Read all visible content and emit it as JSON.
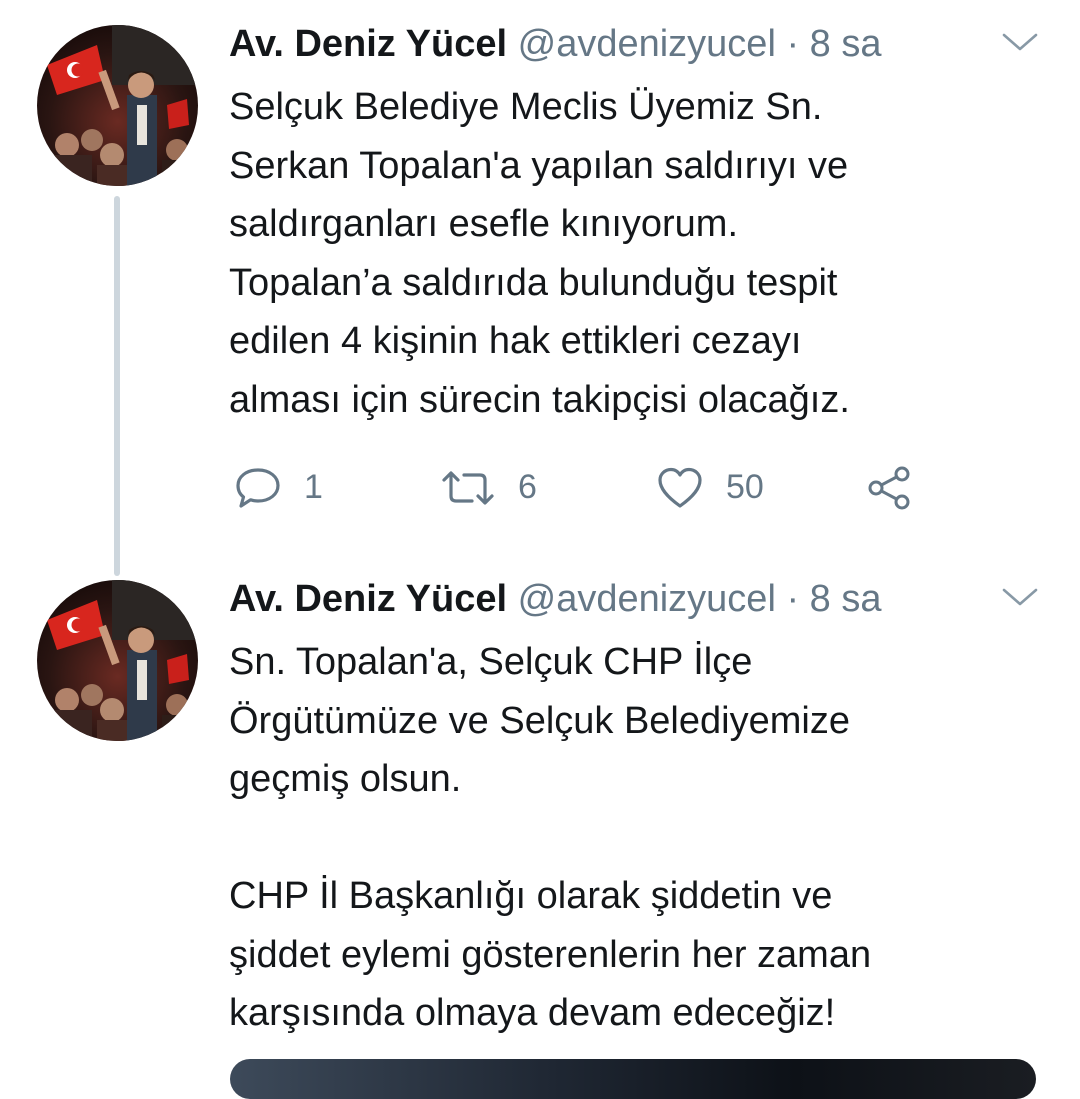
{
  "colors": {
    "text": "#14171a",
    "secondary": "#657786",
    "thread_line": "#cdd6dd"
  },
  "thread": [
    {
      "author_name": "Av. Deniz Yücel",
      "handle": "@avdenizyucel",
      "separator": "·",
      "time": "8 sa",
      "text": "Selçuk Belediye Meclis Üyemiz Sn.\nSerkan Topalan'a yapılan saldırıyı ve\nsaldırganları esefle kınıyorum.\nTopalan’a saldırıda bulunduğu tespit\nedilen 4 kişinin hak ettikleri cezayı\nalması için sürecin takipçisi olacağız.",
      "replies": "1",
      "retweets": "6",
      "likes": "50",
      "icons": [
        "reply-icon",
        "retweet-icon",
        "heart-icon",
        "share-icon",
        "chevron-down-icon"
      ]
    },
    {
      "author_name": "Av. Deniz Yücel",
      "handle": "@avdenizyucel",
      "separator": "·",
      "time": "8 sa",
      "text": "Sn. Topalan'a, Selçuk CHP İlçe\nÖrgütümüze ve Selçuk Belediyemize\ngeçmiş olsun.\n\nCHP İl Başkanlığı olarak şiddetin ve\nşiddet eylemi gösterenlerin her zaman\nkarşısında olmaya devam edeceğiz!",
      "icons": [
        "chevron-down-icon"
      ]
    }
  ]
}
